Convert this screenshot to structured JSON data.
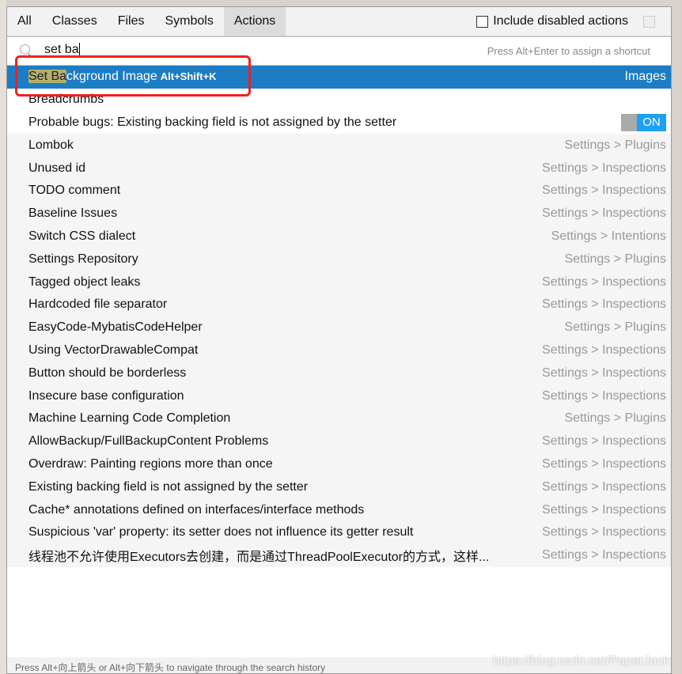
{
  "tabs": [
    {
      "label": "All"
    },
    {
      "label": "Classes"
    },
    {
      "label": "Files"
    },
    {
      "label": "Symbols"
    },
    {
      "label": "Actions",
      "active": true
    }
  ],
  "include_disabled": {
    "label": "Include disabled actions",
    "checked": false
  },
  "search": {
    "value": "set ba",
    "hint": "Press Alt+Enter to assign a shortcut"
  },
  "selected": {
    "highlight": "Set Ba",
    "rest": "ckground Image",
    "shortcut": "Alt+Shift+K",
    "location": "Images"
  },
  "rows": [
    {
      "name": "Breadcrumbs",
      "location": ""
    },
    {
      "name": "Probable bugs: Existing backing field is not assigned by the setter",
      "toggle": "ON"
    },
    {
      "name": "Lombok",
      "location": "Settings > Plugins"
    },
    {
      "name": "Unused id",
      "location": "Settings > Inspections"
    },
    {
      "name": "TODO comment",
      "location": "Settings > Inspections"
    },
    {
      "name": "Baseline Issues",
      "location": "Settings > Inspections"
    },
    {
      "name": "Switch CSS dialect",
      "location": "Settings > Intentions"
    },
    {
      "name": "Settings Repository",
      "location": "Settings > Plugins"
    },
    {
      "name": "Tagged object leaks",
      "location": "Settings > Inspections"
    },
    {
      "name": "Hardcoded file separator",
      "location": "Settings > Inspections"
    },
    {
      "name": "EasyCode-MybatisCodeHelper",
      "location": "Settings > Plugins"
    },
    {
      "name": "Using VectorDrawableCompat",
      "location": "Settings > Inspections"
    },
    {
      "name": "Button should be borderless",
      "location": "Settings > Inspections"
    },
    {
      "name": "Insecure base configuration",
      "location": "Settings > Inspections"
    },
    {
      "name": "Machine Learning Code Completion",
      "location": "Settings > Plugins"
    },
    {
      "name": "AllowBackup/FullBackupContent Problems",
      "location": "Settings > Inspections"
    },
    {
      "name": "Overdraw: Painting regions more than once",
      "location": "Settings > Inspections"
    },
    {
      "name": "Existing backing field is not assigned by the setter",
      "location": "Settings > Inspections"
    },
    {
      "name": "Cache* annotations defined on interfaces/interface methods",
      "location": "Settings > Inspections"
    },
    {
      "name": "Suspicious 'var' property: its setter does not influence its getter result",
      "location": "Settings > Inspections"
    },
    {
      "name": "线程池不允许使用Executors去创建，而是通过ThreadPoolExecutor的方式，这样...",
      "location": "Settings > Inspections"
    }
  ],
  "footer": "Press Alt+向上箭头 or Alt+向下箭头 to navigate through the search history",
  "watermark": "https://blog.csdn.net/PaperJack",
  "colors": {
    "selection": "#1d7cc4",
    "highlight": "#b6ae6a",
    "annotation": "#f02020",
    "toggle_on": "#1da1f2"
  }
}
